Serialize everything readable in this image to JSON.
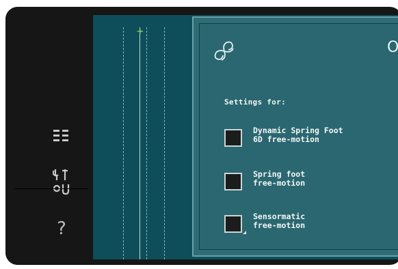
{
  "sidebar": {
    "icons": [
      {
        "name": "list-icon"
      },
      {
        "name": "settings-tools-icon"
      },
      {
        "name": "help-icon",
        "glyph": "?"
      }
    ]
  },
  "dialog": {
    "ok_label": "OK",
    "logo_icon": "spiral-logo-icon",
    "heading": "Settings for:",
    "options": [
      {
        "line1": "Dynamic Spring Foot",
        "line2": "6D free-motion",
        "checked": false
      },
      {
        "line1": "Spring foot",
        "line2": "free-motion",
        "checked": false
      },
      {
        "line1": "Sensormatic",
        "line2": "free-motion",
        "checked": false
      }
    ]
  },
  "colors": {
    "screen_bg": "#0d4e5a",
    "dialog_bg": "#2f6c76",
    "needle_marker": "#8fcf5e"
  }
}
